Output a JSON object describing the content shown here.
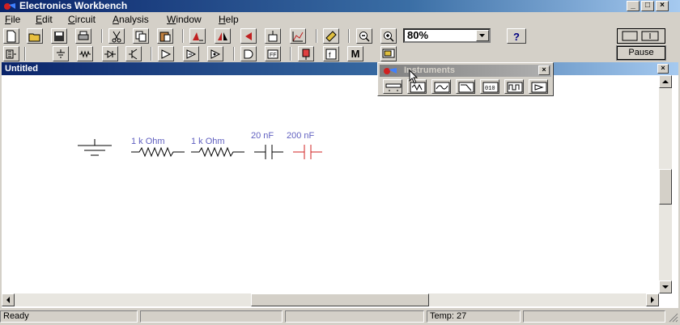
{
  "app": {
    "title": "Electronics Workbench"
  },
  "menu": [
    "File",
    "Edit",
    "Circuit",
    "Analysis",
    "Window",
    "Help"
  ],
  "menu_underline": [
    "F",
    "E",
    "C",
    "A",
    "W",
    "H"
  ],
  "toolbar": {
    "zoom_value": "80%",
    "pause_label": "Pause",
    "m_label": "M"
  },
  "document": {
    "title": "Untitled"
  },
  "instruments": {
    "title": "Instruments"
  },
  "components": [
    {
      "type": "ground",
      "label": ""
    },
    {
      "type": "resistor",
      "label": "1 k Ohm"
    },
    {
      "type": "resistor",
      "label": "1 k Ohm"
    },
    {
      "type": "capacitor",
      "label": "20 nF"
    },
    {
      "type": "capacitor",
      "label": "200 nF",
      "selected": true
    }
  ],
  "status": {
    "text": "Ready",
    "temp": "Temp:  27"
  },
  "colors": {
    "titlebar": "#0a246a",
    "component_label": "#6060c0",
    "selected": "#c02020"
  }
}
